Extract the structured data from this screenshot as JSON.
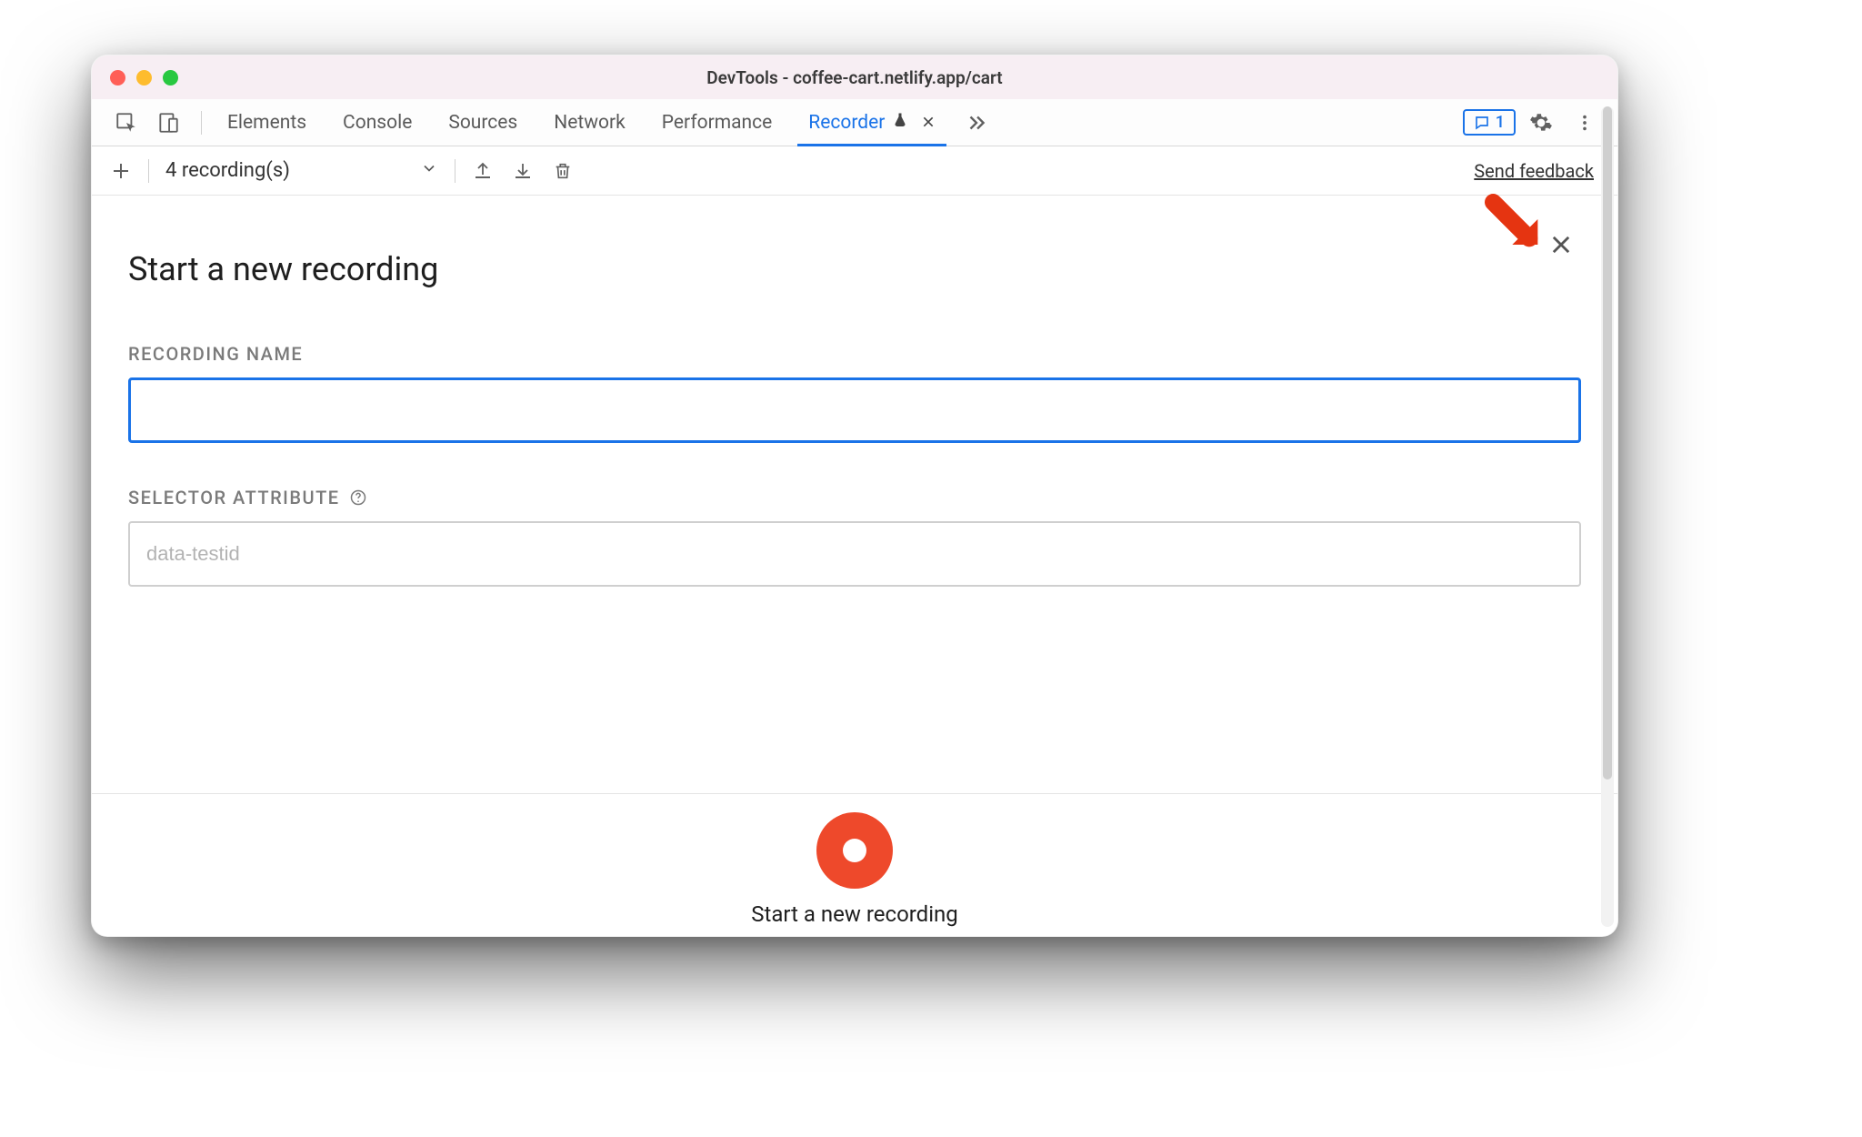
{
  "window": {
    "title": "DevTools - coffee-cart.netlify.app/cart"
  },
  "tabs": {
    "items": [
      {
        "label": "Elements"
      },
      {
        "label": "Console"
      },
      {
        "label": "Sources"
      },
      {
        "label": "Network"
      },
      {
        "label": "Performance"
      },
      {
        "label": "Recorder",
        "active": true,
        "experimental": true,
        "closeable": true
      }
    ],
    "issues_badge_count": "1"
  },
  "toolbar": {
    "dropdown_label": "4 recording(s)",
    "feedback_label": "Send feedback"
  },
  "panel": {
    "title": "Start a new recording",
    "recording_name_label": "RECORDING NAME",
    "recording_name_value": "",
    "selector_attr_label": "SELECTOR ATTRIBUTE",
    "selector_attr_placeholder": "data-testid",
    "selector_attr_value": "",
    "record_button_label": "Start a new recording"
  },
  "colors": {
    "accent": "#1a73e8",
    "record": "#ee492b",
    "annotation": "#e53411"
  }
}
